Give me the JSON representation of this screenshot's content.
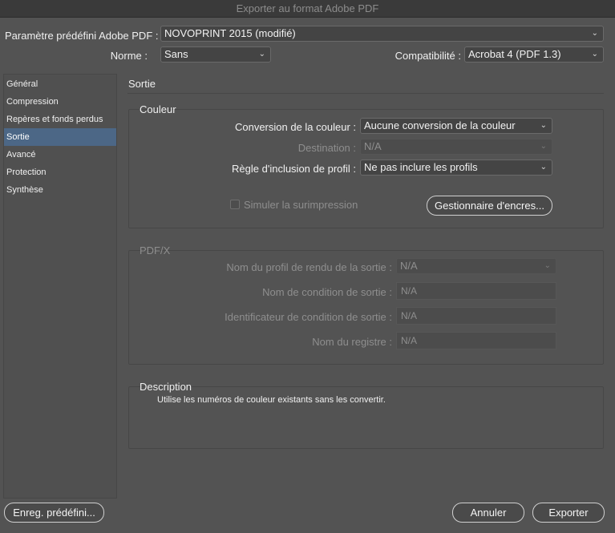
{
  "window": {
    "title": "Exporter au format Adobe PDF"
  },
  "header": {
    "preset_label": "Paramètre prédéfini Adobe PDF :",
    "preset_value": "NOVOPRINT 2015 (modifié)",
    "norme_label": "Norme :",
    "norme_value": "Sans",
    "compat_label": "Compatibilité :",
    "compat_value": "Acrobat 4 (PDF 1.3)"
  },
  "sidebar": {
    "items": [
      {
        "label": "Général"
      },
      {
        "label": "Compression"
      },
      {
        "label": "Repères et fonds perdus"
      },
      {
        "label": "Sortie"
      },
      {
        "label": "Avancé"
      },
      {
        "label": "Protection"
      },
      {
        "label": "Synthèse"
      }
    ],
    "selected": "Sortie"
  },
  "main": {
    "section_title": "Sortie",
    "couleur": {
      "title": "Couleur",
      "conversion_label": "Conversion de la couleur :",
      "conversion_value": "Aucune conversion de la couleur",
      "destination_label": "Destination :",
      "destination_value": "N/A",
      "profile_rule_label": "Règle d'inclusion de profil :",
      "profile_rule_value": "Ne pas inclure les profils",
      "overprint_label": "Simuler la surimpression",
      "ink_manager_label": "Gestionnaire d'encres..."
    },
    "pdfx": {
      "title": "PDF/X",
      "output_profile_label": "Nom du profil de rendu de la sortie :",
      "output_profile_value": "N/A",
      "condition_name_label": "Nom de condition de sortie :",
      "condition_name_value": "N/A",
      "condition_id_label": "Identificateur de condition de sortie :",
      "condition_id_value": "N/A",
      "registry_label": "Nom du registre :",
      "registry_value": "N/A"
    },
    "description": {
      "title": "Description",
      "text": "Utilise les numéros de couleur existants sans les convertir."
    }
  },
  "footer": {
    "save_preset": "Enreg. prédéfini...",
    "cancel": "Annuler",
    "export": "Exporter"
  },
  "colors": {
    "background": "#535353",
    "sidebar_selected": "#4c6786",
    "titlebar": "#3a3a3a"
  }
}
